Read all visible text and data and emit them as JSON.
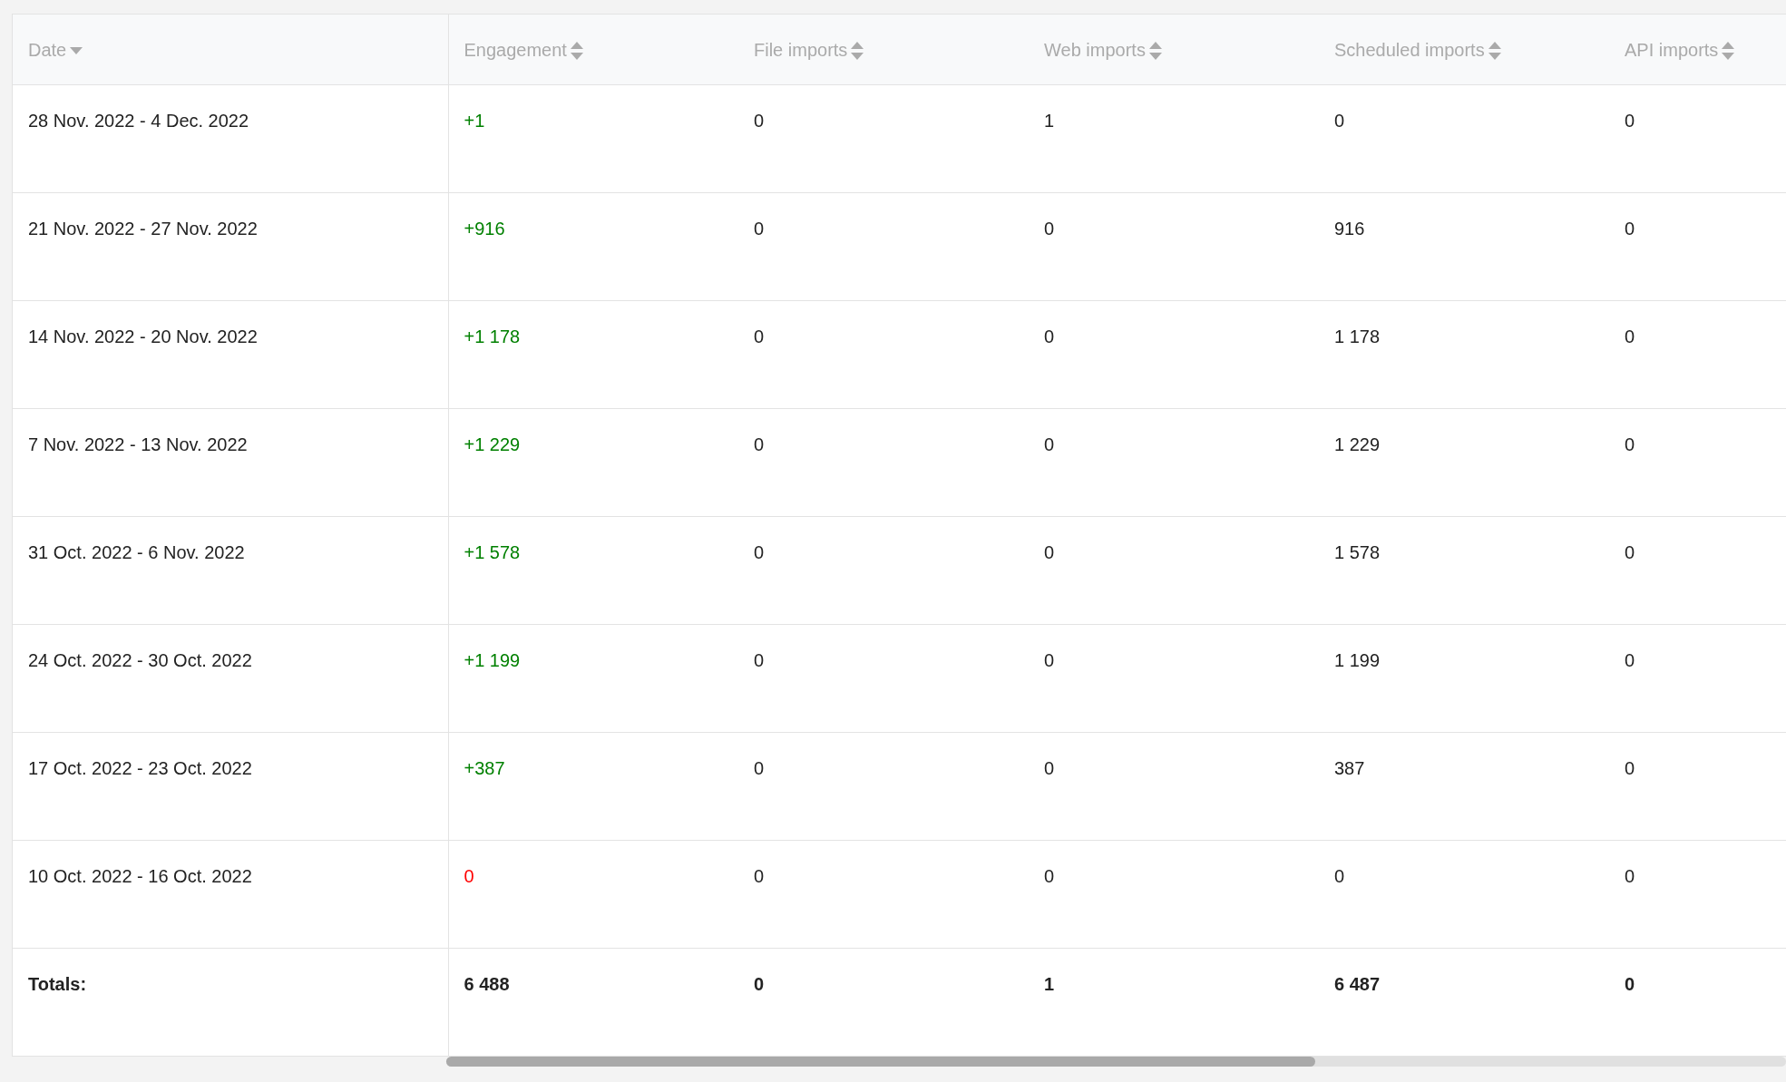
{
  "table": {
    "columns": [
      {
        "label": "Date",
        "sorted": true
      },
      {
        "label": "Engagement",
        "sorted": false
      },
      {
        "label": "File imports",
        "sorted": false
      },
      {
        "label": "Web imports",
        "sorted": false
      },
      {
        "label": "Scheduled imports",
        "sorted": false
      },
      {
        "label": "API imports",
        "sorted": false
      }
    ],
    "rows": [
      {
        "date": "28 Nov. 2022 - 4 Dec. 2022",
        "engagement": "+1",
        "color": "#008000",
        "file": "0",
        "web": "1",
        "scheduled": "0",
        "api": "0"
      },
      {
        "date": "21 Nov. 2022 - 27 Nov. 2022",
        "engagement": "+916",
        "color": "#008000",
        "file": "0",
        "web": "0",
        "scheduled": "916",
        "api": "0"
      },
      {
        "date": "14 Nov. 2022 - 20 Nov. 2022",
        "engagement": "+1 178",
        "color": "#008000",
        "file": "0",
        "web": "0",
        "scheduled": "1 178",
        "api": "0"
      },
      {
        "date": "7 Nov. 2022 - 13 Nov. 2022",
        "engagement": "+1 229",
        "color": "#008000",
        "file": "0",
        "web": "0",
        "scheduled": "1 229",
        "api": "0"
      },
      {
        "date": "31 Oct. 2022 - 6 Nov. 2022",
        "engagement": "+1 578",
        "color": "#008000",
        "file": "0",
        "web": "0",
        "scheduled": "1 578",
        "api": "0"
      },
      {
        "date": "24 Oct. 2022 - 30 Oct. 2022",
        "engagement": "+1 199",
        "color": "#008000",
        "file": "0",
        "web": "0",
        "scheduled": "1 199",
        "api": "0"
      },
      {
        "date": "17 Oct. 2022 - 23 Oct. 2022",
        "engagement": "+387",
        "color": "#008000",
        "file": "0",
        "web": "0",
        "scheduled": "387",
        "api": "0"
      },
      {
        "date": "10 Oct. 2022 - 16 Oct. 2022",
        "engagement": "0",
        "color": "#ff0000",
        "file": "0",
        "web": "0",
        "scheduled": "0",
        "api": "0"
      }
    ],
    "totals": {
      "label": "Totals:",
      "engagement": "6 488",
      "file": "0",
      "web": "1",
      "scheduled": "6 487",
      "api": "0"
    }
  }
}
